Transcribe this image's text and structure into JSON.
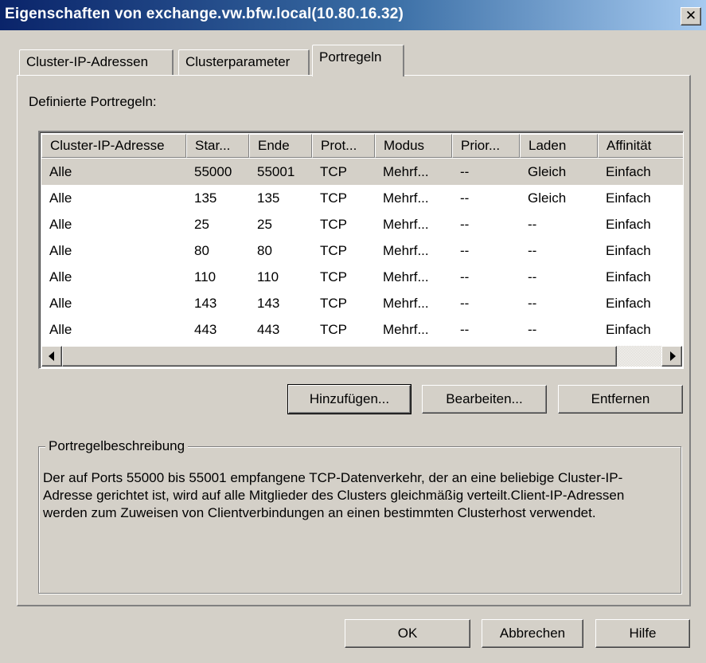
{
  "window": {
    "title": "Eigenschaften von exchange.vw.bfw.local(10.80.16.32)",
    "close_glyph": "✕"
  },
  "tabs": [
    {
      "label": "Cluster-IP-Adressen",
      "active": false
    },
    {
      "label": "Clusterparameter",
      "active": false
    },
    {
      "label": "Portregeln",
      "active": true
    }
  ],
  "panel": {
    "defined_label": "Definierte Portregeln:"
  },
  "table": {
    "columns": [
      "Cluster-IP-Adresse",
      "Star...",
      "Ende",
      "Prot...",
      "Modus",
      "Prior...",
      "Laden",
      "Affinität"
    ],
    "rows": [
      [
        "Alle",
        "55000",
        "55001",
        "TCP",
        "Mehrf...",
        "--",
        "Gleich",
        "Einfach"
      ],
      [
        "Alle",
        "135",
        "135",
        "TCP",
        "Mehrf...",
        "--",
        "Gleich",
        "Einfach"
      ],
      [
        "Alle",
        "25",
        "25",
        "TCP",
        "Mehrf...",
        "--",
        "--",
        "Einfach"
      ],
      [
        "Alle",
        "80",
        "80",
        "TCP",
        "Mehrf...",
        "--",
        "--",
        "Einfach"
      ],
      [
        "Alle",
        "110",
        "110",
        "TCP",
        "Mehrf...",
        "--",
        "--",
        "Einfach"
      ],
      [
        "Alle",
        "143",
        "143",
        "TCP",
        "Mehrf...",
        "--",
        "--",
        "Einfach"
      ],
      [
        "Alle",
        "443",
        "443",
        "TCP",
        "Mehrf...",
        "--",
        "--",
        "Einfach"
      ]
    ],
    "selected_row": 0
  },
  "actions": {
    "add_label": "Hinzufügen...",
    "edit_label": "Bearbeiten...",
    "remove_label": "Entfernen"
  },
  "description": {
    "title": "Portregelbeschreibung",
    "text": "Der auf Ports 55000 bis 55001 empfangene TCP-Datenverkehr, der an eine beliebige Cluster-IP-Adresse gerichtet ist, wird auf alle Mitglieder des Clusters gleichmäßig verteilt.Client-IP-Adressen werden zum Zuweisen von Clientverbindungen an einen bestimmten Clusterhost verwendet."
  },
  "footer": {
    "ok_label": "OK",
    "cancel_label": "Abbrechen",
    "help_label": "Hilfe"
  }
}
